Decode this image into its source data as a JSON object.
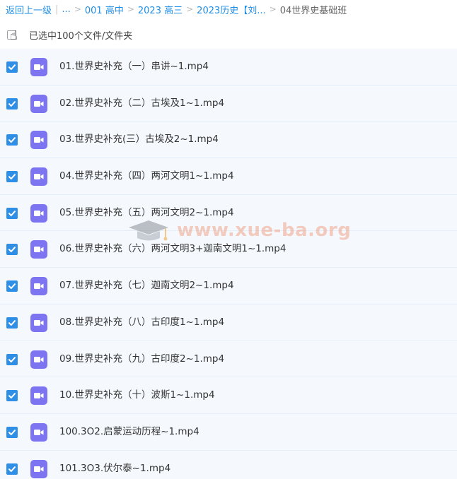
{
  "breadcrumb": {
    "back": "返回上一级",
    "ellipsis": "...",
    "items": [
      "001 高中",
      "2023 高三",
      "2023历史【刘..."
    ],
    "current": "04世界史基础班"
  },
  "selection": {
    "label": "已选中100个文件/文件夹"
  },
  "files": [
    {
      "name": "01.世界史补充（一）串讲~1.mp4"
    },
    {
      "name": "02.世界史补充（二）古埃及1~1.mp4"
    },
    {
      "name": "03.世界史补充(三）古埃及2~1.mp4"
    },
    {
      "name": "04.世界史补充（四）两河文明1~1.mp4"
    },
    {
      "name": "05.世界史补充（五）两河文明2~1.mp4"
    },
    {
      "name": "06.世界史补充（六）两河文明3+迦南文明1~1.mp4"
    },
    {
      "name": "07.世界史补充（七）迦南文明2~1.mp4"
    },
    {
      "name": "08.世界史补充（八）古印度1~1.mp4"
    },
    {
      "name": "09.世界史补充（九）古印度2~1.mp4"
    },
    {
      "name": "10.世界史补充（十）波斯1~1.mp4"
    },
    {
      "name": "100.3O2.启蒙运动历程~1.mp4"
    },
    {
      "name": "101.3O3.伏尔泰~1.mp4"
    }
  ],
  "watermark": {
    "text": "www.xue-ba.org"
  },
  "colors": {
    "accent": "#2f8fe6",
    "video_icon": "#7d74f2",
    "row_bg": "#f5f9fe",
    "watermark": "#f0a58a"
  },
  "icons": {
    "checkbox": "checkmark-icon",
    "file": "video-file-icon",
    "cursor": "hand-cursor-icon",
    "watermark": "graduation-cap-icon"
  }
}
